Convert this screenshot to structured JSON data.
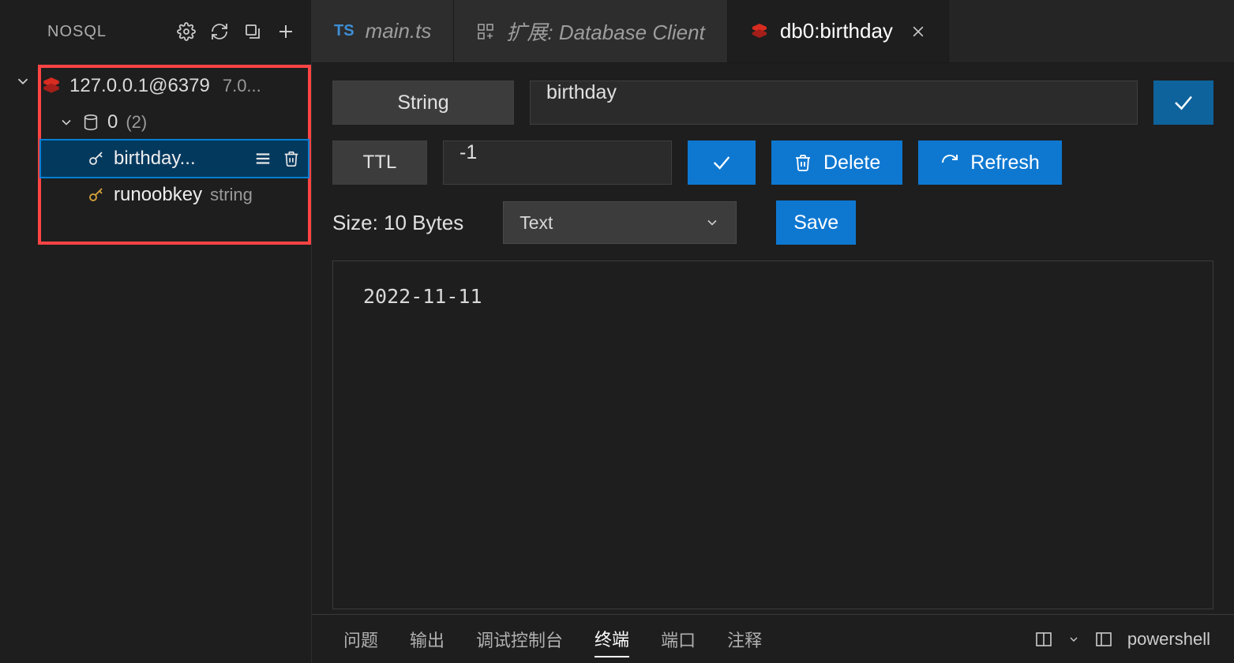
{
  "sidebar": {
    "title": "NOSQL",
    "connection": {
      "label": "127.0.0.1@6379",
      "version": "7.0..."
    },
    "database": {
      "label": "0",
      "count": "(2)"
    },
    "keys": [
      {
        "label": "birthday...",
        "type": "",
        "selected": true
      },
      {
        "label": "runoobkey",
        "type": "string",
        "selected": false
      }
    ]
  },
  "tabs": [
    {
      "icon": "ts",
      "label": "main.ts",
      "italic": true,
      "active": false
    },
    {
      "icon": "ext",
      "label": "扩展: Database Client",
      "italic": true,
      "active": false
    },
    {
      "icon": "redis",
      "label": "db0:birthday",
      "italic": false,
      "active": true,
      "closable": true
    }
  ],
  "detail": {
    "type": "String",
    "name": "birthday",
    "ttl_label": "TTL",
    "ttl_value": "-1",
    "delete_label": "Delete",
    "refresh_label": "Refresh",
    "size_label": "Size: 10 Bytes",
    "format": "Text",
    "save_label": "Save",
    "value": "2022-11-11"
  },
  "bottom": {
    "tabs": [
      "问题",
      "输出",
      "调试控制台",
      "终端",
      "端口",
      "注释"
    ],
    "active": "终端",
    "shell": "powershell"
  }
}
